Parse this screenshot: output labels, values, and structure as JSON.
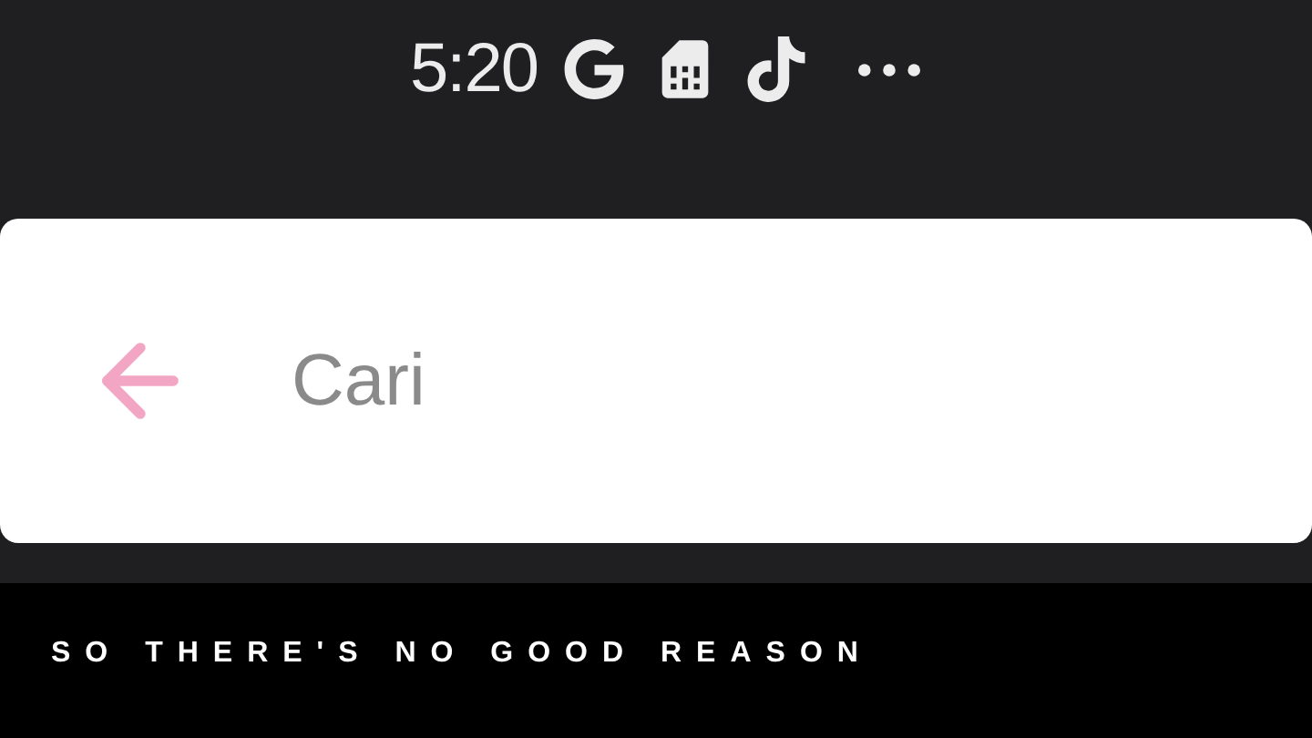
{
  "status_bar": {
    "time": "5:20"
  },
  "search": {
    "placeholder": "Cari"
  },
  "caption": "SO THERE'S NO GOOD REASON"
}
